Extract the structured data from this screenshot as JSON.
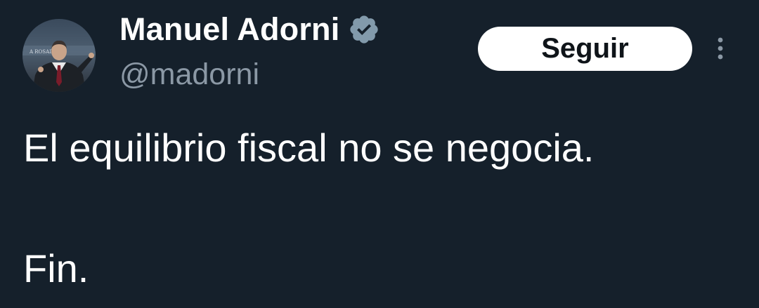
{
  "author": {
    "display_name": "Manuel Adorni",
    "handle": "@madorni",
    "verified": true,
    "avatar_icon": "profile-photo",
    "avatar_caption": "A ROSADA"
  },
  "actions": {
    "follow_label": "Seguir",
    "more_icon": "more-vertical-icon"
  },
  "tweet": {
    "lines": [
      "El equilibrio fiscal no se negocia.",
      "Fin."
    ]
  },
  "colors": {
    "background": "#15202b",
    "primary_text": "#ffffff",
    "secondary_text": "#8b98a5",
    "verified_badge": "#829aab",
    "follow_button_bg": "#ffffff",
    "follow_button_text": "#0f1419"
  }
}
